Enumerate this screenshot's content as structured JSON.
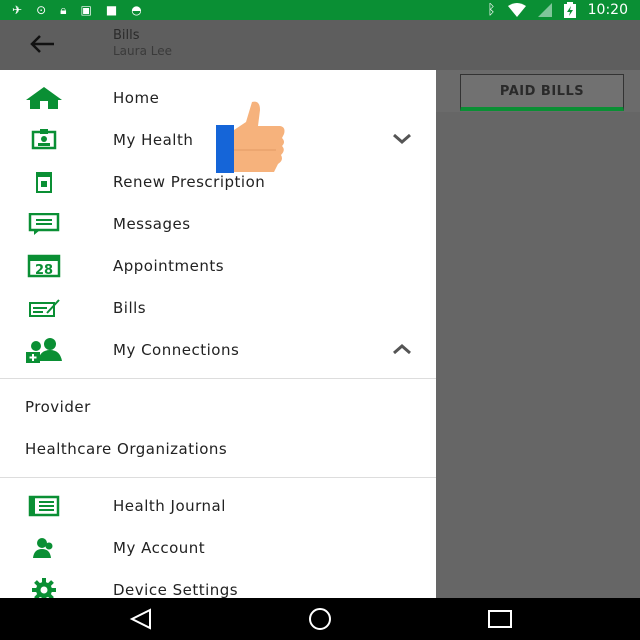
{
  "status": {
    "time": "10:20",
    "left_icons": [
      "satellite-icon",
      "vpn-icon",
      "lock-icon",
      "image-icon",
      "briefcase-icon",
      "android-icon"
    ]
  },
  "header": {
    "title": "Bills",
    "subtitle": "Laura Lee"
  },
  "tabs": {
    "paid_bills": "PAID BILLS"
  },
  "drawer": {
    "items": [
      {
        "label": "Home",
        "icon": "home-icon"
      },
      {
        "label": "My Health",
        "icon": "health-id-icon"
      },
      {
        "label": "Renew Prescription",
        "icon": "prescription-icon"
      },
      {
        "label": "Messages",
        "icon": "message-icon"
      },
      {
        "label": "Appointments",
        "icon": "calendar-icon",
        "icon_text": "28"
      },
      {
        "label": "Bills",
        "icon": "bill-icon"
      },
      {
        "label": "My Connections",
        "icon": "connections-icon"
      }
    ],
    "connections": [
      {
        "label": "Provider"
      },
      {
        "label": "Healthcare Organizations"
      }
    ],
    "bottom": [
      {
        "label": "Health Journal",
        "icon": "journal-icon"
      },
      {
        "label": "My Account",
        "icon": "account-icon"
      },
      {
        "label": "Device Settings",
        "icon": "settings-icon"
      }
    ]
  },
  "colors": {
    "accent": "#0a8f34",
    "status_bar": "#0a8f34",
    "scrim": "#666666"
  }
}
